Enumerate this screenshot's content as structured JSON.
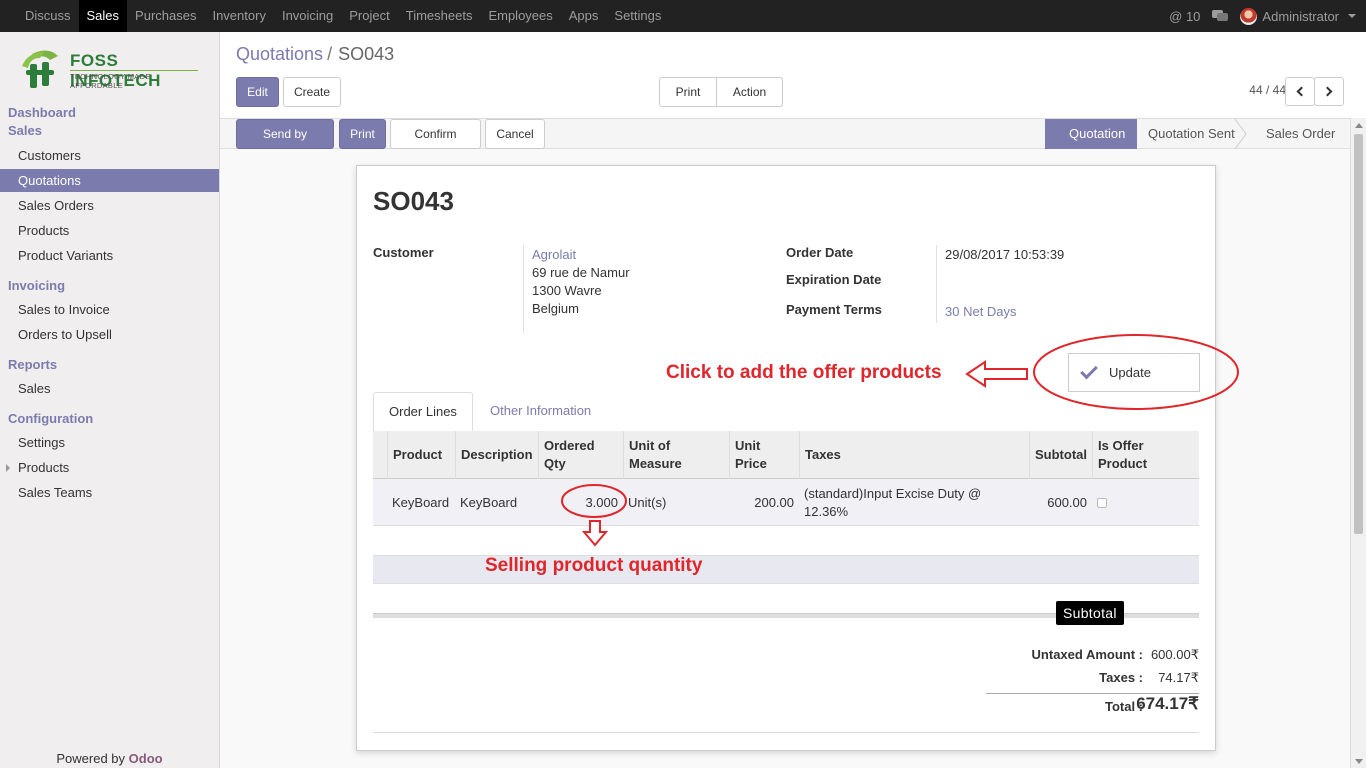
{
  "topnav": {
    "items": [
      "Discuss",
      "Sales",
      "Purchases",
      "Inventory",
      "Invoicing",
      "Project",
      "Timesheets",
      "Employees",
      "Apps",
      "Settings"
    ],
    "active": "Sales",
    "mentions": "@ 10",
    "user": "Administrator"
  },
  "sidebar": {
    "logo_brand": "FOSS INFOTECH",
    "logo_tagline": "TECHNOLOGY MADE AFFORDABLE",
    "dashboard": "Dashboard",
    "sales_head": "Sales",
    "sales_items": [
      "Customers",
      "Quotations",
      "Sales Orders",
      "Products",
      "Product Variants"
    ],
    "invoicing_head": "Invoicing",
    "invoicing_items": [
      "Sales to Invoice",
      "Orders to Upsell"
    ],
    "reports_head": "Reports",
    "reports_items": [
      "Sales"
    ],
    "config_head": "Configuration",
    "config_items": [
      "Settings",
      "Products",
      "Sales Teams"
    ],
    "powered_prefix": "Powered by",
    "powered_brand": "Odoo"
  },
  "header": {
    "breadcrumb_parent": "Quotations",
    "breadcrumb_sep": "/",
    "breadcrumb_current": "SO043",
    "edit": "Edit",
    "create": "Create",
    "print": "Print",
    "action": "Action",
    "pager": "44 / 44"
  },
  "statusbar": {
    "send_email": "Send by Email",
    "print": "Print",
    "confirm": "Confirm Sale",
    "cancel": "Cancel",
    "stages": [
      "Quotation",
      "Quotation Sent",
      "Sales Order"
    ],
    "active_stage": "Quotation"
  },
  "form": {
    "title": "SO043",
    "customer_label": "Customer",
    "customer_name": "Agrolait",
    "address": [
      "69 rue de Namur",
      "1300 Wavre",
      "Belgium"
    ],
    "order_date_label": "Order Date",
    "order_date": "29/08/2017 10:53:39",
    "expiration_label": "Expiration Date",
    "payment_terms_label": "Payment Terms",
    "payment_terms": "30 Net Days",
    "update_button": "Update",
    "annotation_offer": "Click to add the offer products",
    "annotation_qty": "Selling product quantity",
    "tabs": [
      "Order Lines",
      "Other Information"
    ],
    "columns": [
      "Product",
      "Description",
      "Ordered Qty",
      "Unit of Measure",
      "Unit Price",
      "Taxes",
      "Subtotal",
      "Is Offer Product"
    ],
    "rows": [
      {
        "product": "KeyBoard",
        "description": "KeyBoard",
        "qty": "3.000",
        "uom": "Unit(s)",
        "price": "200.00",
        "taxes": "(standard)Input Excise Duty @ 12.36%",
        "subtotal": "600.00"
      }
    ],
    "tooltip": "Subtotal",
    "untaxed_label": "Untaxed Amount :",
    "untaxed": "600.00₹",
    "taxes_label": "Taxes :",
    "taxes": "74.17₹",
    "total_label": "Total :",
    "total": "674.17₹"
  },
  "colors": {
    "accent": "#7c7bad",
    "annotation": "#e0262b",
    "topbar": "#222222"
  }
}
